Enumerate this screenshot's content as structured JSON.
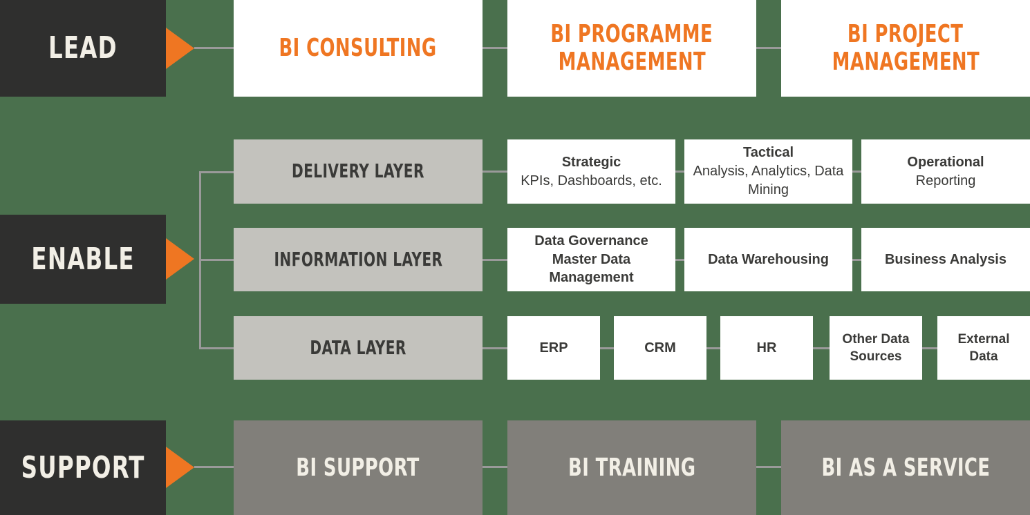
{
  "colors": {
    "background_green": "#4a704d",
    "stage_dark": "#2f2f2e",
    "accent_orange": "#ef7622",
    "layer_gray": "#c3c2bd",
    "support_gray": "#817f7a",
    "connector_gray": "#9a9a9a",
    "card_white": "#ffffff",
    "text_dark": "#3a3a38",
    "text_light": "#f2efe6"
  },
  "stages": {
    "lead": {
      "label": "LEAD"
    },
    "enable": {
      "label": "ENABLE"
    },
    "support": {
      "label": "SUPPORT"
    }
  },
  "lead_row": {
    "items": [
      {
        "label": "BI CONSULTING"
      },
      {
        "label": "BI PROGRAMME MANAGEMENT",
        "line1": "BI PROGRAMME",
        "line2": "MANAGEMENT"
      },
      {
        "label": "BI PROJECT MANAGEMENT",
        "line1": "BI PROJECT",
        "line2": "MANAGEMENT"
      }
    ]
  },
  "enable_rows": [
    {
      "layer": "DELIVERY LAYER",
      "cards": [
        {
          "title": "Strategic",
          "detail": "KPIs, Dashboards, etc."
        },
        {
          "title": "Tactical",
          "detail": "Analysis, Analytics, Data Mining"
        },
        {
          "title": "Operational",
          "detail": "Reporting"
        }
      ]
    },
    {
      "layer": "INFORMATION LAYER",
      "cards": [
        {
          "title": "Data Governance Master Data Management",
          "line1": "Data Governance",
          "line2": "Master Data",
          "line3": "Management"
        },
        {
          "title": "Data Warehousing"
        },
        {
          "title": "Business Analysis"
        }
      ]
    },
    {
      "layer": "DATA LAYER",
      "cards": [
        {
          "title": "ERP"
        },
        {
          "title": "CRM"
        },
        {
          "title": "HR"
        },
        {
          "title": "Other Data Sources",
          "line1": "Other Data",
          "line2": "Sources"
        },
        {
          "title": "External Data",
          "line1": "External",
          "line2": "Data"
        }
      ]
    }
  ],
  "support_row": {
    "items": [
      {
        "label": "BI SUPPORT"
      },
      {
        "label": "BI TRAINING"
      },
      {
        "label": "BI AS A SERVICE"
      }
    ]
  }
}
